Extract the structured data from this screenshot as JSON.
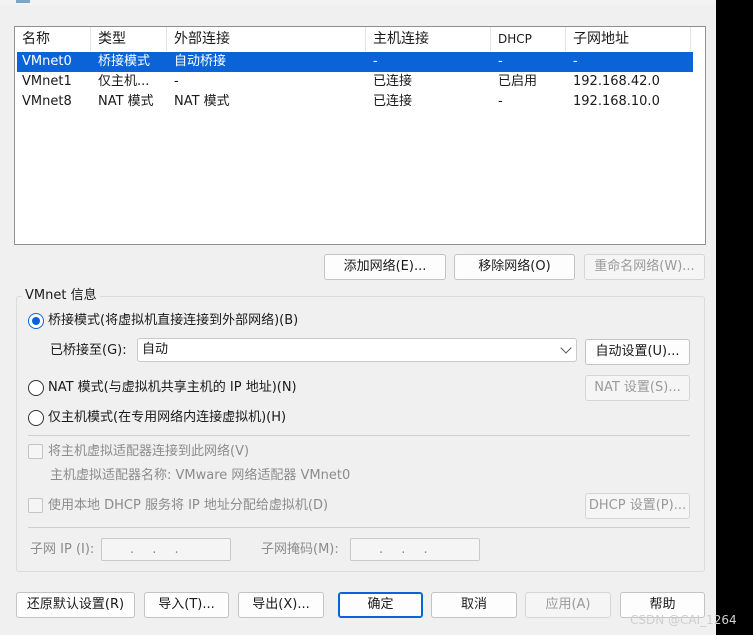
{
  "list": {
    "headers": {
      "name": "名称",
      "type": "类型",
      "external": "外部连接",
      "host": "主机连接",
      "dhcp": "DHCP",
      "subnet": "子网地址"
    },
    "rows": [
      {
        "name": "VMnet0",
        "type": "桥接模式",
        "external": "自动桥接",
        "host": "-",
        "dhcp": "-",
        "subnet": "-"
      },
      {
        "name": "VMnet1",
        "type": "仅主机...",
        "external": "-",
        "host": "已连接",
        "dhcp": "已启用",
        "subnet": "192.168.42.0"
      },
      {
        "name": "VMnet8",
        "type": "NAT 模式",
        "external": "NAT 模式",
        "host": "已连接",
        "dhcp": "-",
        "subnet": "192.168.10.0"
      }
    ]
  },
  "network_buttons": {
    "add": "添加网络(E)...",
    "remove": "移除网络(O)",
    "rename": "重命名网络(W)..."
  },
  "vmnet_info": {
    "group_label": "VMnet 信息",
    "bridged_radio": "桥接模式(将虚拟机直接连接到外部网络)(B)",
    "bridged_to_label": "已桥接至(G):",
    "bridged_to_value": "自动",
    "auto_settings": "自动设置(U)...",
    "nat_radio": "NAT 模式(与虚拟机共享主机的 IP 地址)(N)",
    "nat_settings": "NAT 设置(S)...",
    "host_only_radio": "仅主机模式(在专用网络内连接虚拟机)(H)",
    "connect_adapter_check": "将主机虚拟适配器连接到此网络(V)",
    "adapter_name_text": "主机虚拟适配器名称: VMware 网络适配器 VMnet0",
    "dhcp_check": "使用本地 DHCP 服务将 IP 地址分配给虚拟机(D)",
    "dhcp_settings": "DHCP 设置(P)...",
    "subnet_ip_label": "子网 IP (I):",
    "subnet_mask_label": "子网掩码(M):",
    "ip_placeholder": ". . ."
  },
  "footer": {
    "restore": "还原默认设置(R)",
    "import": "导入(T)...",
    "export": "导出(X)...",
    "ok": "确定",
    "cancel": "取消",
    "apply": "应用(A)",
    "help": "帮助"
  },
  "watermark": "CSDN @CAI_1264",
  "colors": {
    "selection": "#0a64d8",
    "dialog_bg": "#f0f0f0"
  }
}
